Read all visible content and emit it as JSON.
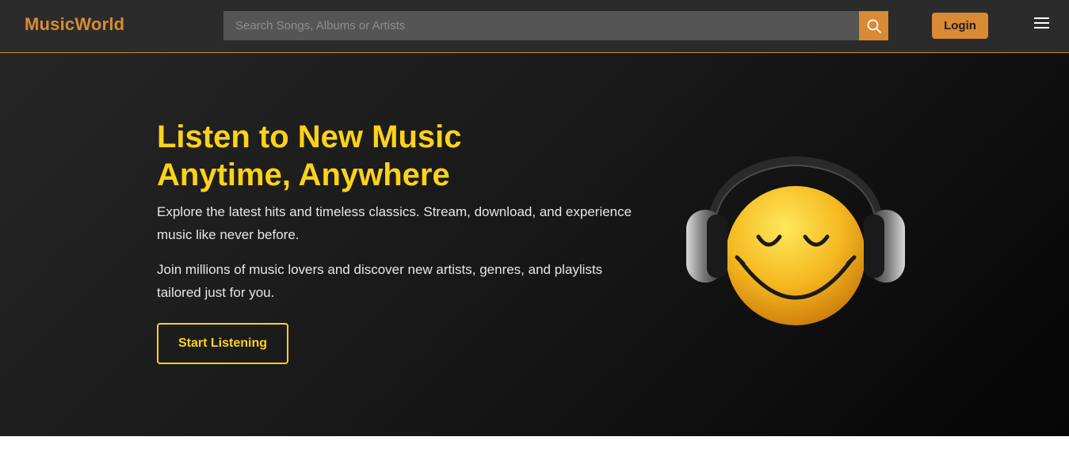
{
  "header": {
    "brand": "MusicWorld",
    "search": {
      "placeholder": "Search Songs, Albums or Artists",
      "value": ""
    },
    "search_icon": "search-icon",
    "login_label": "Login",
    "menu_icon": "hamburger-menu-icon"
  },
  "hero": {
    "title_line1": "Listen to New Music",
    "title_line2": "Anytime, Anywhere",
    "paragraph1": "Explore the latest hits and timeless classics. Stream, download, and experience music like never before.",
    "paragraph2": "Join millions of music lovers and discover new artists, genres, and playlists tailored just for you.",
    "cta_label": "Start Listening",
    "image_icon": "smiley-headphones-icon"
  },
  "colors": {
    "accent_orange": "#d98a32",
    "accent_yellow": "#ffd21a",
    "nav_bg": "#2b2b2b",
    "hero_bg": "#1a1a1a"
  }
}
